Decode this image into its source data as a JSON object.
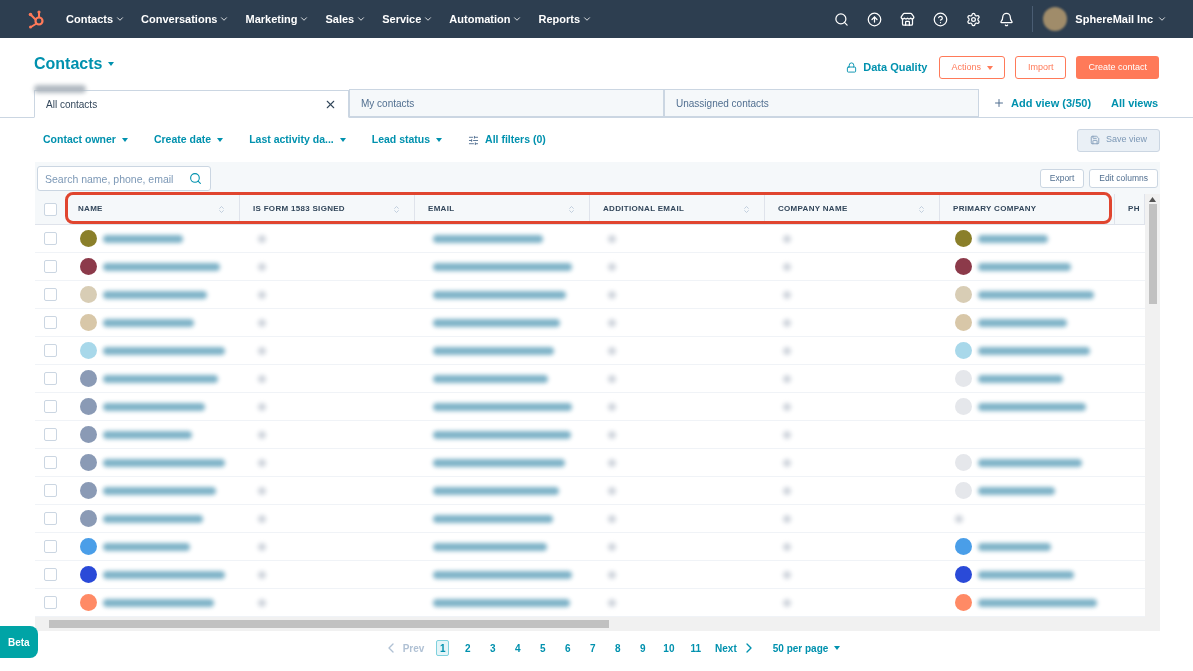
{
  "nav": {
    "items": [
      {
        "label": "Contacts"
      },
      {
        "label": "Conversations"
      },
      {
        "label": "Marketing"
      },
      {
        "label": "Sales"
      },
      {
        "label": "Service"
      },
      {
        "label": "Automation"
      },
      {
        "label": "Reports"
      }
    ],
    "account": "SphereMail Inc"
  },
  "header": {
    "title": "Contacts",
    "data_quality": "Data Quality",
    "actions": "Actions",
    "import": "Import",
    "create": "Create contact"
  },
  "tabs": [
    {
      "label": "All contacts",
      "selected": true,
      "closable": true
    },
    {
      "label": "My contacts",
      "selected": false,
      "closable": false
    },
    {
      "label": "Unassigned contacts",
      "selected": false,
      "closable": false
    }
  ],
  "add_view": "Add view (3/50)",
  "all_views": "All views",
  "filters": [
    {
      "label": "Contact owner"
    },
    {
      "label": "Create date"
    },
    {
      "label": "Last activity da..."
    },
    {
      "label": "Lead status"
    }
  ],
  "all_filters": "All filters (0)",
  "save_view": "Save view",
  "search": {
    "placeholder": "Search name, phone, email"
  },
  "export": "Export",
  "edit_columns": "Edit columns",
  "table": {
    "columns": [
      {
        "label": "NAME",
        "sortable": true
      },
      {
        "label": "IS FORM 1583 SIGNED",
        "sortable": true
      },
      {
        "label": "EMAIL",
        "sortable": true
      },
      {
        "label": "ADDITIONAL EMAIL",
        "sortable": true
      },
      {
        "label": "COMPANY NAME",
        "sortable": true
      },
      {
        "label": "PRIMARY COMPANY",
        "sortable": false
      },
      {
        "label": "PH"
      }
    ],
    "all_checked": false,
    "rows": [
      {
        "checked": false,
        "color": "#8a7f2a",
        "company": {
          "color": "#8a7f2a"
        }
      },
      {
        "checked": false,
        "color": "#8c3a4a",
        "company": {
          "color": "#8c3a4a"
        }
      },
      {
        "checked": false,
        "color": "#d8cdb5",
        "company": {
          "color": "#d8cdb5"
        }
      },
      {
        "checked": false,
        "color": "#d8c7a8",
        "company": {
          "color": "#d8c7a8"
        }
      },
      {
        "checked": false,
        "color": "#a8d8ea",
        "company": {
          "color": "#a8d8ea"
        }
      },
      {
        "checked": false,
        "color": "#8a9ab5",
        "company": {
          "color": "#e5e7eb"
        }
      },
      {
        "checked": false,
        "color": "#8a9ab5",
        "company": {
          "color": "#e5e7eb"
        }
      },
      {
        "checked": false,
        "color": "#8a9ab5"
      },
      {
        "checked": false,
        "color": "#8a9ab5",
        "company": {
          "color": "#e5e7eb"
        }
      },
      {
        "checked": false,
        "color": "#8a9ab5",
        "company": {
          "color": "#e5e7eb"
        }
      },
      {
        "checked": false,
        "color": "#8a9ab5"
      },
      {
        "checked": false,
        "color": "#4a9ee8",
        "company": {
          "color": "#4a9ee8"
        }
      },
      {
        "checked": false,
        "color": "#2a4ad8",
        "company": {
          "color": "#2a4ad8"
        }
      },
      {
        "checked": false,
        "color": "#ff8a65",
        "company": {
          "color": "#ff8a65"
        }
      }
    ]
  },
  "pagination": {
    "prev": "Prev",
    "pages": [
      {
        "label": "1",
        "selected": true
      },
      {
        "label": "2",
        "selected": false
      },
      {
        "label": "3",
        "selected": false
      },
      {
        "label": "4",
        "selected": false
      },
      {
        "label": "5",
        "selected": false
      },
      {
        "label": "6",
        "selected": false
      },
      {
        "label": "7",
        "selected": false
      },
      {
        "label": "8",
        "selected": false
      },
      {
        "label": "9",
        "selected": false
      },
      {
        "label": "10",
        "selected": false
      },
      {
        "label": "11",
        "selected": false
      }
    ],
    "next": "Next",
    "per_page": "50 per page"
  },
  "beta": "Beta"
}
